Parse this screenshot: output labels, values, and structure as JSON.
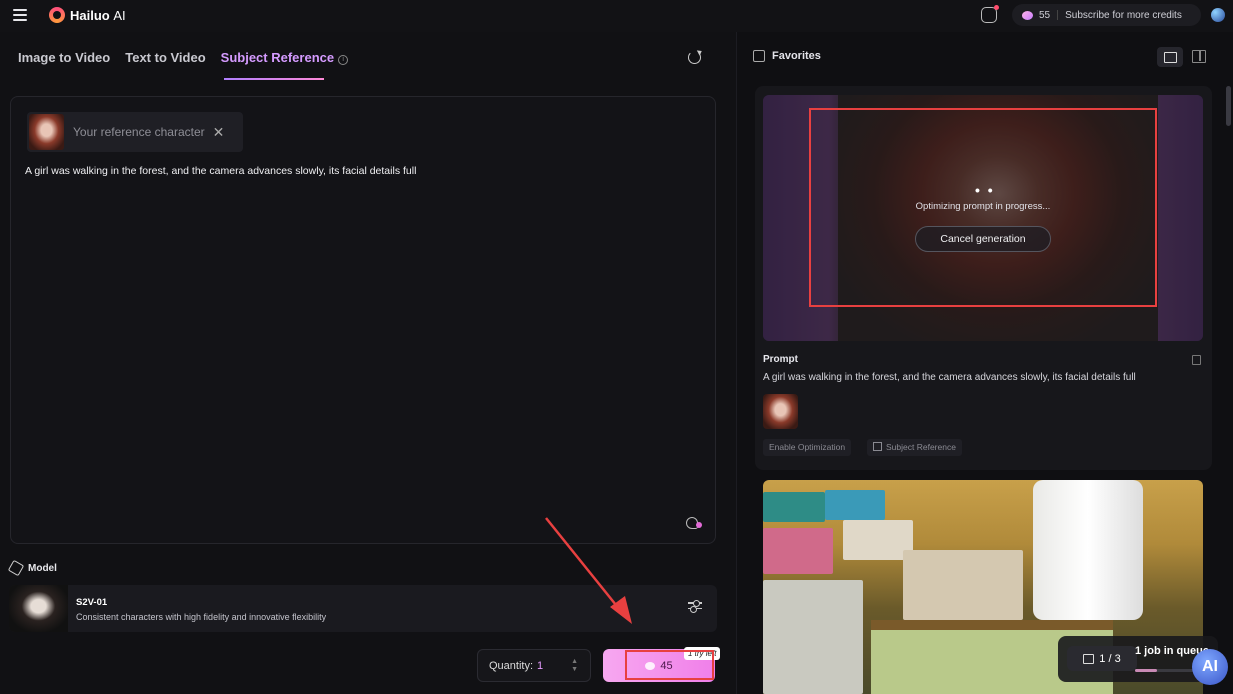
{
  "app": {
    "name_bold": "Hailuo",
    "name_light": "AI"
  },
  "header": {
    "credits": "55",
    "subscribe_label": "Subscribe for more credits"
  },
  "tabs": [
    {
      "label": "Image to Video"
    },
    {
      "label": "Text to Video"
    },
    {
      "label": "Subject Reference"
    }
  ],
  "prompt": {
    "reference_label": "Your reference character",
    "text": "A girl was walking in the forest, and the camera advances slowly, its facial details full"
  },
  "model": {
    "heading": "Model",
    "name": "S2V-01",
    "description": "Consistent characters with high fidelity and innovative flexibility"
  },
  "footer": {
    "quantity_label": "Quantity:",
    "quantity_value": "1",
    "generate_cost": "45",
    "try_badge": "1 try left"
  },
  "right_panel": {
    "favorites_label": "Favorites",
    "status_text": "Optimizing prompt in progress...",
    "cancel_label": "Cancel generation",
    "prompt_heading": "Prompt",
    "prompt_text": "A girl was walking in the forest, and the camera advances slowly, its facial details full",
    "tag_optimization": "Enable Optimization",
    "tag_reference": "Subject Reference",
    "queue_count": "1 / 3",
    "queue_text": "1 job in queue",
    "brand_badge": "AI"
  },
  "colors": {
    "accent": "#d59bff",
    "highlight": "#e84040",
    "generate": "#f07fe9"
  }
}
